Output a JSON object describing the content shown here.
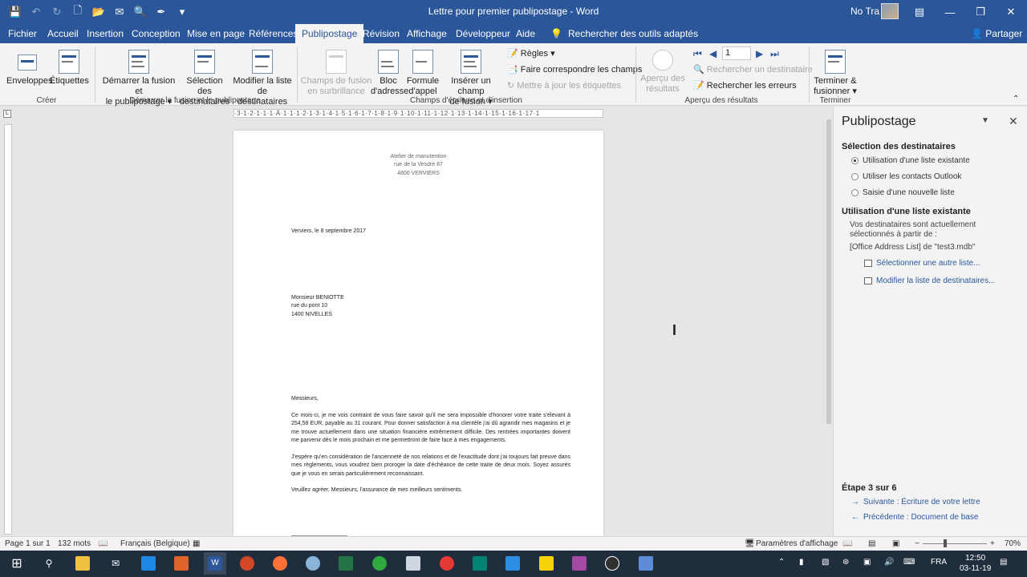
{
  "window": {
    "title": "Lettre pour premier publipostage - Word",
    "user": "No Tra"
  },
  "tabs": [
    "Fichier",
    "Accueil",
    "Insertion",
    "Conception",
    "Mise en page",
    "Références",
    "Publipostage",
    "Révision",
    "Affichage",
    "Développeur",
    "Aide"
  ],
  "search_tools": "Rechercher des outils adaptés",
  "share": "Partager",
  "ribbon": {
    "creer": {
      "envelopes": "Enveloppes",
      "labels": "Étiquettes",
      "group": "Créer"
    },
    "start": {
      "start_merge_1": "Démarrer la fusion et",
      "start_merge_2": "le publipostage",
      "select_1": "Sélection des",
      "select_2": "destinataires",
      "edit_1": "Modifier la liste",
      "edit_2": "de destinataires",
      "group": "Démarrer la fusion et le publipostage"
    },
    "fields": {
      "highlight_1": "Champs de fusion",
      "highlight_2": "en surbrillance",
      "address_1": "Bloc",
      "address_2": "d'adresse",
      "greeting_1": "Formule",
      "greeting_2": "d'appel",
      "insert_1": "Insérer un champ",
      "insert_2": "de fusion",
      "rules": "Règles",
      "match": "Faire correspondre les champs",
      "update": "Mettre à jour les étiquettes",
      "group": "Champs d'écriture et d'insertion"
    },
    "preview": {
      "preview_1": "Aperçu des",
      "preview_2": "résultats",
      "record": "1",
      "find_recipient": "Rechercher un destinataire",
      "check_errors": "Rechercher les erreurs",
      "group": "Aperçu des résultats"
    },
    "finish": {
      "finish_1": "Terminer &",
      "finish_2": "fusionner",
      "group": "Terminer"
    }
  },
  "ruler_text": "·3·1·2·1·1·1·Ä·1·1·1·2·1·3·1·4·1·5·1·6·1·7·1·8·1·9·1·10·1·11·1·12·1·13·1·14·1·15·1·16·1·17·1",
  "document": {
    "sender": [
      "Atelier de manutention",
      "rue de la Vesdre 87",
      "4800 VERVIERS"
    ],
    "date": "Verviers, le 8 septembre 2017",
    "recipient": [
      "Monsieur BENIOTTE",
      "rue du pont 10",
      "1400 NIVELLES"
    ],
    "salutation": "Messieurs,",
    "paragraphs": [
      "Ce mois-ci, je me vois contraint de vous faire savoir qu'il me sera impossible d'honorer votre traite s'élevant à 254,58 EUR, payable au 31 courant. Pour donner satisfaction à ma clientèle j'ai dû agrandir mes magasins et je me trouve actuellement dans une situation financière extrêmement difficile. Des rentrées importantes doivent me parvenir dès le mois prochain et me permettront de faire face à mes engagements.",
      "J'espère qu'en considération de l'ancienneté de nos relations et de l'exactitude dont j'ai toujours fait preuve dans mes règlements, vous voudrez bien proroger la date d'échéance de cette traite de deux mois. Soyez assurés que je vous en serais particulièrement reconnaissant.",
      "Veuillez agréer, Messieurs, l'assurance de mes meilleurs sentiments."
    ]
  },
  "pane": {
    "title": "Publipostage",
    "section1": "Sélection des destinataires",
    "options": [
      "Utilisation d'une liste existante",
      "Utiliser les contacts Outlook",
      "Saisie d'une nouvelle liste"
    ],
    "section2": "Utilisation d'une liste existante",
    "info": "Vos destinataires sont actuellement sélectionnés à partir de :",
    "source": "[Office Address List] de \"test3.mdb\"",
    "link_select": "Sélectionner une autre liste...",
    "link_edit": "Modifier la liste de destinataires...",
    "step": "Étape 3 sur 6",
    "next": "Suivante : Écriture de votre lettre",
    "prev": "Précédente : Document de base"
  },
  "status": {
    "page": "Page 1 sur 1",
    "words": "132 mots",
    "language": "Français (Belgique)",
    "display": "Paramètres d'affichage",
    "zoom": "70%"
  },
  "taskbar": {
    "lang": "FRA",
    "time": "12:50",
    "date": "03-11-19"
  },
  "colors": {
    "word_blue": "#2b579a",
    "ribbon_bg": "#f3f3f3",
    "taskbar": "#1f2d3d"
  }
}
